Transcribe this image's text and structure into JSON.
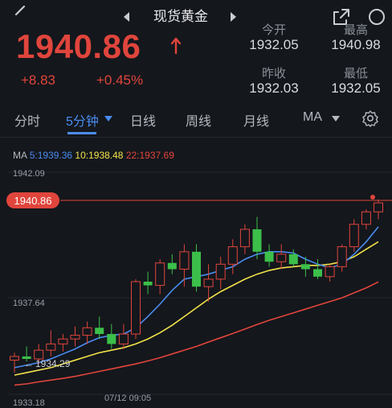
{
  "header": {
    "title": "现货黄金"
  },
  "quote": {
    "price": "1940.86",
    "change": "+8.83",
    "change_pct": "+0.45%",
    "open_label": "今开",
    "open_value": "1932.05",
    "high_label": "最高",
    "high_value": "1940.98",
    "prev_close_label": "昨收",
    "prev_close_value": "1932.03",
    "low_label": "最低",
    "low_value": "1932.05",
    "up_color": "#e0453c"
  },
  "tabs": [
    {
      "label": "分时"
    },
    {
      "label": "5分钟",
      "active": true
    },
    {
      "label": "日线"
    },
    {
      "label": "周线"
    },
    {
      "label": "月线"
    },
    {
      "label": "MA"
    }
  ],
  "ma_legend": {
    "prefix": "MA",
    "ma5": "5:1939.36",
    "ma10": "10:1938.48",
    "ma22": "22:1937.69",
    "ma5_color": "#4a8cf0",
    "ma10_color": "#f2e24a",
    "ma22_color": "#e0453c"
  },
  "chart_data": {
    "type": "candlestick",
    "y_top_label": "1942.09",
    "y_mid_label": "1937.64",
    "y_bottom_label": "1933.18",
    "current_price_label": "1940.86",
    "low_marker_label": "1934.29",
    "time_label": "07/12 09:05",
    "ylim": [
      1933.18,
      1942.09
    ],
    "candles": [
      {
        "o": 1934.55,
        "h": 1934.85,
        "l": 1934.05,
        "c": 1934.7
      },
      {
        "o": 1934.7,
        "h": 1935.1,
        "l": 1934.5,
        "c": 1934.6
      },
      {
        "o": 1934.6,
        "h": 1935.2,
        "l": 1934.4,
        "c": 1934.95
      },
      {
        "o": 1934.95,
        "h": 1935.75,
        "l": 1934.7,
        "c": 1935.2
      },
      {
        "o": 1935.2,
        "h": 1935.6,
        "l": 1934.9,
        "c": 1935.4
      },
      {
        "o": 1935.4,
        "h": 1935.9,
        "l": 1935.1,
        "c": 1935.55
      },
      {
        "o": 1935.55,
        "h": 1936.1,
        "l": 1935.2,
        "c": 1935.85
      },
      {
        "o": 1935.85,
        "h": 1936.3,
        "l": 1935.4,
        "c": 1935.6
      },
      {
        "o": 1935.6,
        "h": 1936.0,
        "l": 1935.0,
        "c": 1935.2
      },
      {
        "o": 1935.2,
        "h": 1936.0,
        "l": 1935.0,
        "c": 1935.6
      },
      {
        "o": 1935.6,
        "h": 1937.8,
        "l": 1935.4,
        "c": 1937.7
      },
      {
        "o": 1937.7,
        "h": 1938.1,
        "l": 1937.2,
        "c": 1937.55
      },
      {
        "o": 1937.55,
        "h": 1938.6,
        "l": 1937.2,
        "c": 1938.45
      },
      {
        "o": 1938.45,
        "h": 1938.8,
        "l": 1938.0,
        "c": 1938.2
      },
      {
        "o": 1938.2,
        "h": 1939.2,
        "l": 1937.5,
        "c": 1938.9
      },
      {
        "o": 1938.9,
        "h": 1939.2,
        "l": 1937.3,
        "c": 1937.5
      },
      {
        "o": 1937.5,
        "h": 1938.4,
        "l": 1936.9,
        "c": 1937.8
      },
      {
        "o": 1937.8,
        "h": 1938.7,
        "l": 1937.4,
        "c": 1938.4
      },
      {
        "o": 1938.4,
        "h": 1939.4,
        "l": 1938.0,
        "c": 1939.1
      },
      {
        "o": 1939.1,
        "h": 1940.0,
        "l": 1938.8,
        "c": 1939.8
      },
      {
        "o": 1939.8,
        "h": 1940.3,
        "l": 1938.6,
        "c": 1938.9
      },
      {
        "o": 1938.9,
        "h": 1939.2,
        "l": 1938.3,
        "c": 1938.5
      },
      {
        "o": 1938.5,
        "h": 1939.2,
        "l": 1938.2,
        "c": 1938.8
      },
      {
        "o": 1938.8,
        "h": 1939.0,
        "l": 1938.3,
        "c": 1938.4
      },
      {
        "o": 1938.4,
        "h": 1938.7,
        "l": 1937.9,
        "c": 1938.2
      },
      {
        "o": 1938.2,
        "h": 1938.6,
        "l": 1937.8,
        "c": 1937.9
      },
      {
        "o": 1937.9,
        "h": 1938.4,
        "l": 1937.7,
        "c": 1938.3
      },
      {
        "o": 1938.3,
        "h": 1939.2,
        "l": 1938.1,
        "c": 1939.1
      },
      {
        "o": 1939.1,
        "h": 1940.2,
        "l": 1938.9,
        "c": 1940.0
      },
      {
        "o": 1940.0,
        "h": 1940.6,
        "l": 1939.8,
        "c": 1940.5
      },
      {
        "o": 1940.5,
        "h": 1941.0,
        "l": 1940.2,
        "c": 1940.86
      }
    ],
    "ma5": [
      1934.25,
      1934.35,
      1934.45,
      1934.6,
      1934.8,
      1935.0,
      1935.25,
      1935.45,
      1935.55,
      1935.6,
      1935.85,
      1936.3,
      1936.8,
      1937.35,
      1937.8,
      1937.9,
      1938.0,
      1938.15,
      1938.3,
      1938.6,
      1938.8,
      1938.9,
      1938.9,
      1938.85,
      1938.6,
      1938.4,
      1938.25,
      1938.4,
      1938.8,
      1939.3,
      1939.9
    ],
    "ma10": [
      1933.95,
      1934.05,
      1934.15,
      1934.25,
      1934.4,
      1934.55,
      1934.7,
      1934.85,
      1934.95,
      1935.05,
      1935.2,
      1935.4,
      1935.65,
      1935.95,
      1936.3,
      1936.65,
      1937.0,
      1937.3,
      1937.55,
      1937.8,
      1938.0,
      1938.15,
      1938.25,
      1938.3,
      1938.35,
      1938.35,
      1938.4,
      1938.5,
      1938.7,
      1939.0,
      1939.3
    ],
    "ma22": [
      1933.55,
      1933.6,
      1933.68,
      1933.75,
      1933.82,
      1933.9,
      1934.0,
      1934.1,
      1934.2,
      1934.3,
      1934.4,
      1934.52,
      1934.65,
      1934.8,
      1934.95,
      1935.1,
      1935.28,
      1935.45,
      1935.62,
      1935.8,
      1935.98,
      1936.15,
      1936.3,
      1936.45,
      1936.6,
      1936.75,
      1936.9,
      1937.05,
      1937.25,
      1937.45,
      1937.69
    ],
    "up_color": "#e0453c",
    "down_color": "#3cbf4a"
  }
}
